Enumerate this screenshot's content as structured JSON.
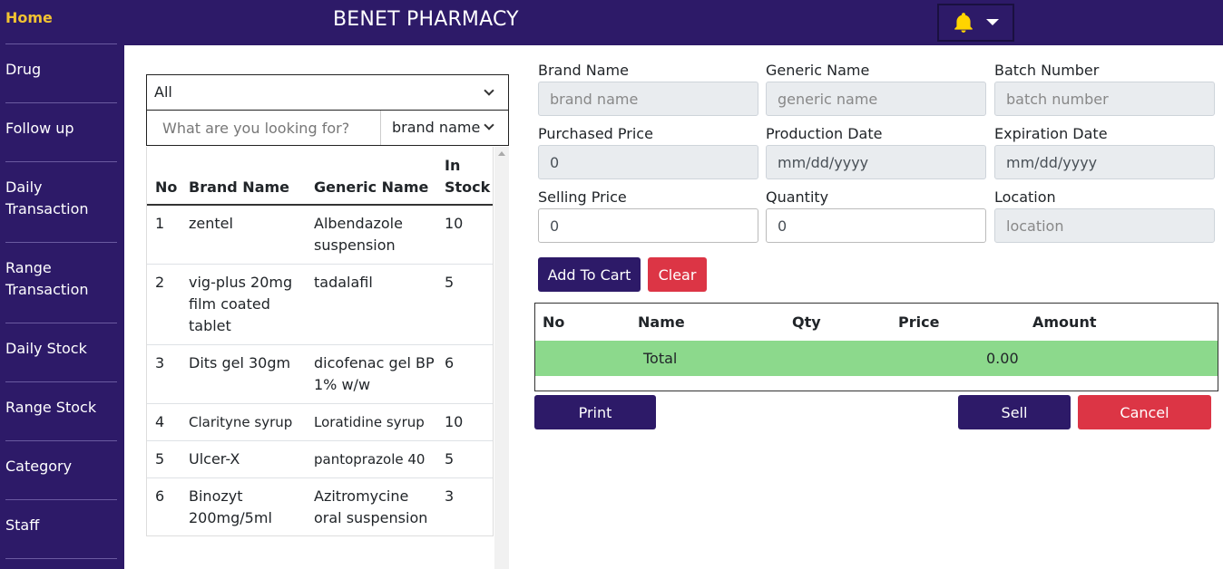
{
  "app": {
    "title": "BENET PHARMACY"
  },
  "sidebar": {
    "items": [
      {
        "label": "Home",
        "active": true
      },
      {
        "label": "Drug"
      },
      {
        "label": "Follow up"
      },
      {
        "label": "Daily Transaction"
      },
      {
        "label": "Range Transaction"
      },
      {
        "label": "Daily Stock"
      },
      {
        "label": "Range Stock"
      },
      {
        "label": "Category"
      },
      {
        "label": "Staff"
      }
    ]
  },
  "header": {
    "notification_icon": "bell-icon",
    "dropdown_icon": "caret-down-icon"
  },
  "filter": {
    "category_value": "All",
    "search_placeholder": "What are you looking for?",
    "search_field_value": "brand name"
  },
  "drug_table": {
    "columns": [
      "No",
      "Brand Name",
      "Generic Name",
      "In Stock"
    ],
    "rows": [
      {
        "no": "1",
        "brand": "zentel",
        "generic": "Albendazole suspension",
        "stock": "10"
      },
      {
        "no": "2",
        "brand": "vig-plus 20mg film coated tablet",
        "generic": "tadalafil",
        "stock": "5"
      },
      {
        "no": "3",
        "brand": "Dits gel 30gm",
        "generic": "dicofenac gel BP 1% w/w",
        "stock": "6"
      },
      {
        "no": "4",
        "brand": "Clarityne syrup",
        "generic": "Loratidine syrup",
        "stock": "10"
      },
      {
        "no": "5",
        "brand": "Ulcer-X",
        "generic": "pantoprazole 40",
        "stock": "5"
      },
      {
        "no": "6",
        "brand": "Binozyt 200mg/5ml",
        "generic": "Azitromycine oral suspension",
        "stock": "3"
      }
    ]
  },
  "form": {
    "brand_name": {
      "label": "Brand Name",
      "placeholder": "brand name"
    },
    "generic_name": {
      "label": "Generic Name",
      "placeholder": "generic name"
    },
    "batch_number": {
      "label": "Batch Number",
      "placeholder": "batch number"
    },
    "purchased_price": {
      "label": "Purchased Price",
      "value": "0"
    },
    "production_date": {
      "label": "Production Date",
      "value": "mm/dd/yyyy"
    },
    "expiration_date": {
      "label": "Expiration Date",
      "value": "mm/dd/yyyy"
    },
    "selling_price": {
      "label": "Selling Price",
      "value": "0"
    },
    "quantity": {
      "label": "Quantity",
      "value": "0"
    },
    "location": {
      "label": "Location",
      "placeholder": "location"
    },
    "add_to_cart_label": "Add To Cart",
    "clear_label": "Clear"
  },
  "cart": {
    "columns": [
      "No",
      "Name",
      "Qty",
      "Price",
      "Amount"
    ],
    "total_label": "Total",
    "total_value": "0.00"
  },
  "actions": {
    "print_label": "Print",
    "sell_label": "Sell",
    "cancel_label": "Cancel"
  },
  "colors": {
    "primary": "#2d1a68",
    "danger": "#dc3545",
    "total_row": "#8cd98c",
    "active_nav": "#f1c232",
    "bell": "#ffd400"
  }
}
